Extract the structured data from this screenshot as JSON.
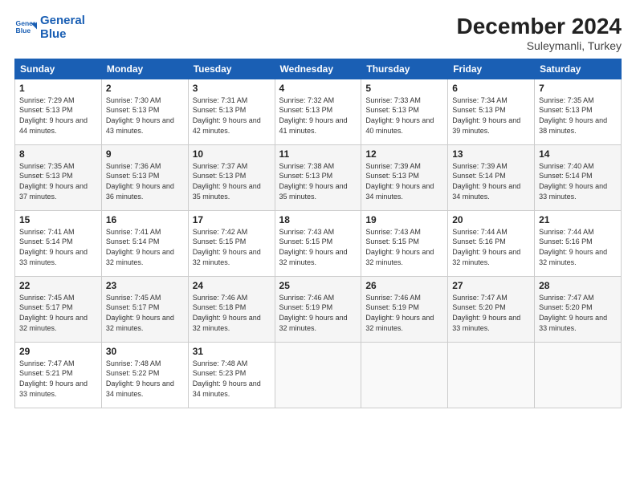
{
  "logo": {
    "line1": "General",
    "line2": "Blue"
  },
  "title": "December 2024",
  "subtitle": "Suleymanli, Turkey",
  "headers": [
    "Sunday",
    "Monday",
    "Tuesday",
    "Wednesday",
    "Thursday",
    "Friday",
    "Saturday"
  ],
  "weeks": [
    [
      {
        "day": "1",
        "sunrise": "7:29 AM",
        "sunset": "5:13 PM",
        "daylight": "9 hours and 44 minutes."
      },
      {
        "day": "2",
        "sunrise": "7:30 AM",
        "sunset": "5:13 PM",
        "daylight": "9 hours and 43 minutes."
      },
      {
        "day": "3",
        "sunrise": "7:31 AM",
        "sunset": "5:13 PM",
        "daylight": "9 hours and 42 minutes."
      },
      {
        "day": "4",
        "sunrise": "7:32 AM",
        "sunset": "5:13 PM",
        "daylight": "9 hours and 41 minutes."
      },
      {
        "day": "5",
        "sunrise": "7:33 AM",
        "sunset": "5:13 PM",
        "daylight": "9 hours and 40 minutes."
      },
      {
        "day": "6",
        "sunrise": "7:34 AM",
        "sunset": "5:13 PM",
        "daylight": "9 hours and 39 minutes."
      },
      {
        "day": "7",
        "sunrise": "7:35 AM",
        "sunset": "5:13 PM",
        "daylight": "9 hours and 38 minutes."
      }
    ],
    [
      {
        "day": "8",
        "sunrise": "7:35 AM",
        "sunset": "5:13 PM",
        "daylight": "9 hours and 37 minutes."
      },
      {
        "day": "9",
        "sunrise": "7:36 AM",
        "sunset": "5:13 PM",
        "daylight": "9 hours and 36 minutes."
      },
      {
        "day": "10",
        "sunrise": "7:37 AM",
        "sunset": "5:13 PM",
        "daylight": "9 hours and 35 minutes."
      },
      {
        "day": "11",
        "sunrise": "7:38 AM",
        "sunset": "5:13 PM",
        "daylight": "9 hours and 35 minutes."
      },
      {
        "day": "12",
        "sunrise": "7:39 AM",
        "sunset": "5:13 PM",
        "daylight": "9 hours and 34 minutes."
      },
      {
        "day": "13",
        "sunrise": "7:39 AM",
        "sunset": "5:14 PM",
        "daylight": "9 hours and 34 minutes."
      },
      {
        "day": "14",
        "sunrise": "7:40 AM",
        "sunset": "5:14 PM",
        "daylight": "9 hours and 33 minutes."
      }
    ],
    [
      {
        "day": "15",
        "sunrise": "7:41 AM",
        "sunset": "5:14 PM",
        "daylight": "9 hours and 33 minutes."
      },
      {
        "day": "16",
        "sunrise": "7:41 AM",
        "sunset": "5:14 PM",
        "daylight": "9 hours and 32 minutes."
      },
      {
        "day": "17",
        "sunrise": "7:42 AM",
        "sunset": "5:15 PM",
        "daylight": "9 hours and 32 minutes."
      },
      {
        "day": "18",
        "sunrise": "7:43 AM",
        "sunset": "5:15 PM",
        "daylight": "9 hours and 32 minutes."
      },
      {
        "day": "19",
        "sunrise": "7:43 AM",
        "sunset": "5:15 PM",
        "daylight": "9 hours and 32 minutes."
      },
      {
        "day": "20",
        "sunrise": "7:44 AM",
        "sunset": "5:16 PM",
        "daylight": "9 hours and 32 minutes."
      },
      {
        "day": "21",
        "sunrise": "7:44 AM",
        "sunset": "5:16 PM",
        "daylight": "9 hours and 32 minutes."
      }
    ],
    [
      {
        "day": "22",
        "sunrise": "7:45 AM",
        "sunset": "5:17 PM",
        "daylight": "9 hours and 32 minutes."
      },
      {
        "day": "23",
        "sunrise": "7:45 AM",
        "sunset": "5:17 PM",
        "daylight": "9 hours and 32 minutes."
      },
      {
        "day": "24",
        "sunrise": "7:46 AM",
        "sunset": "5:18 PM",
        "daylight": "9 hours and 32 minutes."
      },
      {
        "day": "25",
        "sunrise": "7:46 AM",
        "sunset": "5:19 PM",
        "daylight": "9 hours and 32 minutes."
      },
      {
        "day": "26",
        "sunrise": "7:46 AM",
        "sunset": "5:19 PM",
        "daylight": "9 hours and 32 minutes."
      },
      {
        "day": "27",
        "sunrise": "7:47 AM",
        "sunset": "5:20 PM",
        "daylight": "9 hours and 33 minutes."
      },
      {
        "day": "28",
        "sunrise": "7:47 AM",
        "sunset": "5:20 PM",
        "daylight": "9 hours and 33 minutes."
      }
    ],
    [
      {
        "day": "29",
        "sunrise": "7:47 AM",
        "sunset": "5:21 PM",
        "daylight": "9 hours and 33 minutes."
      },
      {
        "day": "30",
        "sunrise": "7:48 AM",
        "sunset": "5:22 PM",
        "daylight": "9 hours and 34 minutes."
      },
      {
        "day": "31",
        "sunrise": "7:48 AM",
        "sunset": "5:23 PM",
        "daylight": "9 hours and 34 minutes."
      },
      null,
      null,
      null,
      null
    ]
  ],
  "labels": {
    "sunrise": "Sunrise:",
    "sunset": "Sunset:",
    "daylight": "Daylight:"
  }
}
